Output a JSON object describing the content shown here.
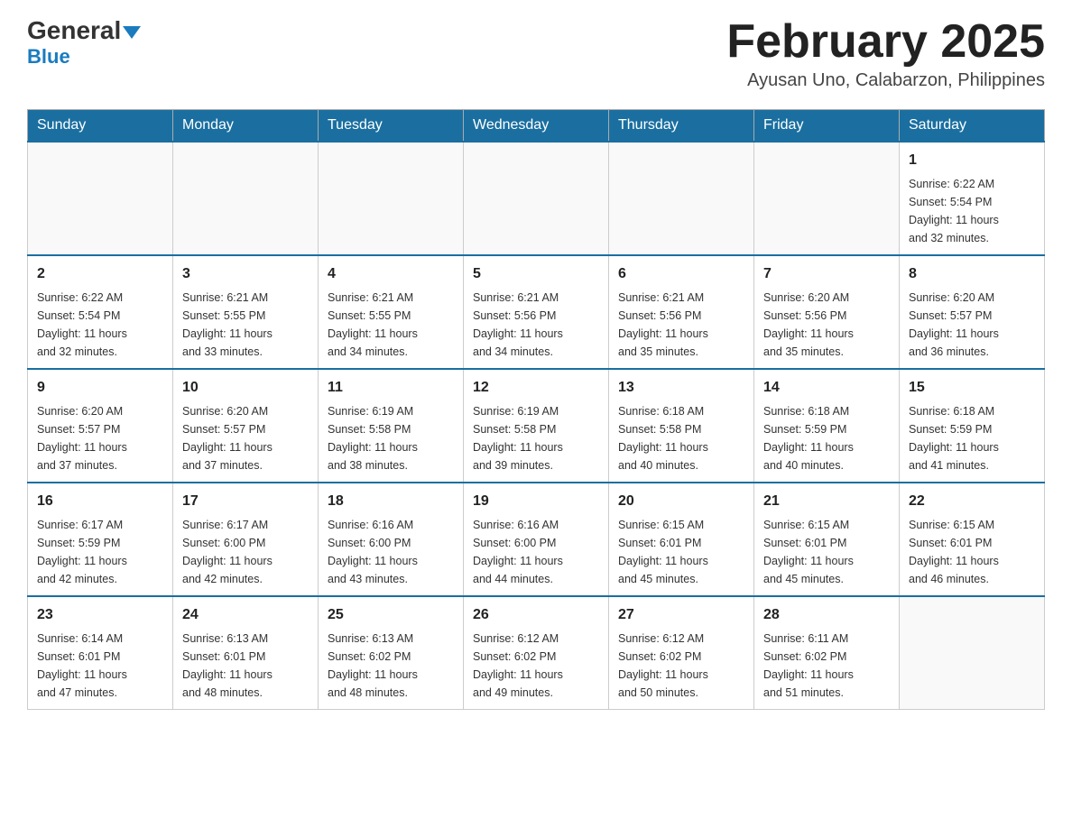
{
  "logo": {
    "general": "General",
    "blue": "Blue",
    "triangle": "▼"
  },
  "header": {
    "month": "February 2025",
    "location": "Ayusan Uno, Calabarzon, Philippines"
  },
  "weekdays": [
    "Sunday",
    "Monday",
    "Tuesday",
    "Wednesday",
    "Thursday",
    "Friday",
    "Saturday"
  ],
  "weeks": [
    [
      {
        "day": "",
        "info": ""
      },
      {
        "day": "",
        "info": ""
      },
      {
        "day": "",
        "info": ""
      },
      {
        "day": "",
        "info": ""
      },
      {
        "day": "",
        "info": ""
      },
      {
        "day": "",
        "info": ""
      },
      {
        "day": "1",
        "info": "Sunrise: 6:22 AM\nSunset: 5:54 PM\nDaylight: 11 hours\nand 32 minutes."
      }
    ],
    [
      {
        "day": "2",
        "info": "Sunrise: 6:22 AM\nSunset: 5:54 PM\nDaylight: 11 hours\nand 32 minutes."
      },
      {
        "day": "3",
        "info": "Sunrise: 6:21 AM\nSunset: 5:55 PM\nDaylight: 11 hours\nand 33 minutes."
      },
      {
        "day": "4",
        "info": "Sunrise: 6:21 AM\nSunset: 5:55 PM\nDaylight: 11 hours\nand 34 minutes."
      },
      {
        "day": "5",
        "info": "Sunrise: 6:21 AM\nSunset: 5:56 PM\nDaylight: 11 hours\nand 34 minutes."
      },
      {
        "day": "6",
        "info": "Sunrise: 6:21 AM\nSunset: 5:56 PM\nDaylight: 11 hours\nand 35 minutes."
      },
      {
        "day": "7",
        "info": "Sunrise: 6:20 AM\nSunset: 5:56 PM\nDaylight: 11 hours\nand 35 minutes."
      },
      {
        "day": "8",
        "info": "Sunrise: 6:20 AM\nSunset: 5:57 PM\nDaylight: 11 hours\nand 36 minutes."
      }
    ],
    [
      {
        "day": "9",
        "info": "Sunrise: 6:20 AM\nSunset: 5:57 PM\nDaylight: 11 hours\nand 37 minutes."
      },
      {
        "day": "10",
        "info": "Sunrise: 6:20 AM\nSunset: 5:57 PM\nDaylight: 11 hours\nand 37 minutes."
      },
      {
        "day": "11",
        "info": "Sunrise: 6:19 AM\nSunset: 5:58 PM\nDaylight: 11 hours\nand 38 minutes."
      },
      {
        "day": "12",
        "info": "Sunrise: 6:19 AM\nSunset: 5:58 PM\nDaylight: 11 hours\nand 39 minutes."
      },
      {
        "day": "13",
        "info": "Sunrise: 6:18 AM\nSunset: 5:58 PM\nDaylight: 11 hours\nand 40 minutes."
      },
      {
        "day": "14",
        "info": "Sunrise: 6:18 AM\nSunset: 5:59 PM\nDaylight: 11 hours\nand 40 minutes."
      },
      {
        "day": "15",
        "info": "Sunrise: 6:18 AM\nSunset: 5:59 PM\nDaylight: 11 hours\nand 41 minutes."
      }
    ],
    [
      {
        "day": "16",
        "info": "Sunrise: 6:17 AM\nSunset: 5:59 PM\nDaylight: 11 hours\nand 42 minutes."
      },
      {
        "day": "17",
        "info": "Sunrise: 6:17 AM\nSunset: 6:00 PM\nDaylight: 11 hours\nand 42 minutes."
      },
      {
        "day": "18",
        "info": "Sunrise: 6:16 AM\nSunset: 6:00 PM\nDaylight: 11 hours\nand 43 minutes."
      },
      {
        "day": "19",
        "info": "Sunrise: 6:16 AM\nSunset: 6:00 PM\nDaylight: 11 hours\nand 44 minutes."
      },
      {
        "day": "20",
        "info": "Sunrise: 6:15 AM\nSunset: 6:01 PM\nDaylight: 11 hours\nand 45 minutes."
      },
      {
        "day": "21",
        "info": "Sunrise: 6:15 AM\nSunset: 6:01 PM\nDaylight: 11 hours\nand 45 minutes."
      },
      {
        "day": "22",
        "info": "Sunrise: 6:15 AM\nSunset: 6:01 PM\nDaylight: 11 hours\nand 46 minutes."
      }
    ],
    [
      {
        "day": "23",
        "info": "Sunrise: 6:14 AM\nSunset: 6:01 PM\nDaylight: 11 hours\nand 47 minutes."
      },
      {
        "day": "24",
        "info": "Sunrise: 6:13 AM\nSunset: 6:01 PM\nDaylight: 11 hours\nand 48 minutes."
      },
      {
        "day": "25",
        "info": "Sunrise: 6:13 AM\nSunset: 6:02 PM\nDaylight: 11 hours\nand 48 minutes."
      },
      {
        "day": "26",
        "info": "Sunrise: 6:12 AM\nSunset: 6:02 PM\nDaylight: 11 hours\nand 49 minutes."
      },
      {
        "day": "27",
        "info": "Sunrise: 6:12 AM\nSunset: 6:02 PM\nDaylight: 11 hours\nand 50 minutes."
      },
      {
        "day": "28",
        "info": "Sunrise: 6:11 AM\nSunset: 6:02 PM\nDaylight: 11 hours\nand 51 minutes."
      },
      {
        "day": "",
        "info": ""
      }
    ]
  ]
}
